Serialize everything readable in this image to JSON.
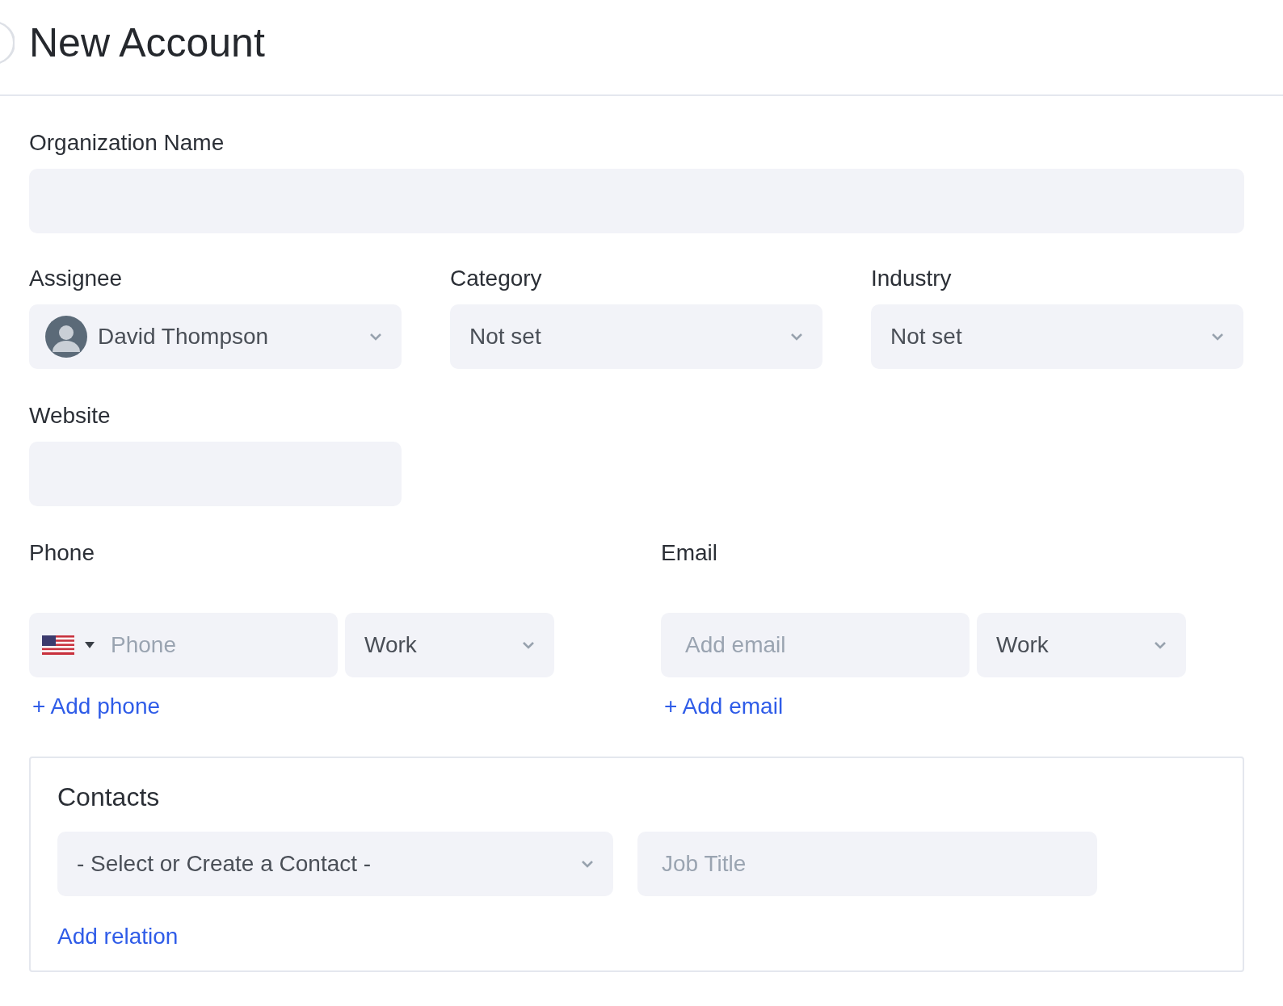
{
  "header": {
    "title": "New Account"
  },
  "organization_name": {
    "label": "Organization Name"
  },
  "assignee": {
    "label": "Assignee",
    "value": "David Thompson"
  },
  "category": {
    "label": "Category",
    "value": "Not set"
  },
  "industry": {
    "label": "Industry",
    "value": "Not set"
  },
  "website": {
    "label": "Website"
  },
  "phone": {
    "label": "Phone",
    "placeholder": "Phone",
    "type": "Work",
    "add_link": "+ Add phone"
  },
  "email": {
    "label": "Email",
    "placeholder": "Add email",
    "type": "Work",
    "add_link": "+ Add email"
  },
  "contacts": {
    "title": "Contacts",
    "contact_select": "- Select or Create a Contact -",
    "job_title": {
      "placeholder": "Job Title"
    },
    "add_link": "Add relation"
  }
}
